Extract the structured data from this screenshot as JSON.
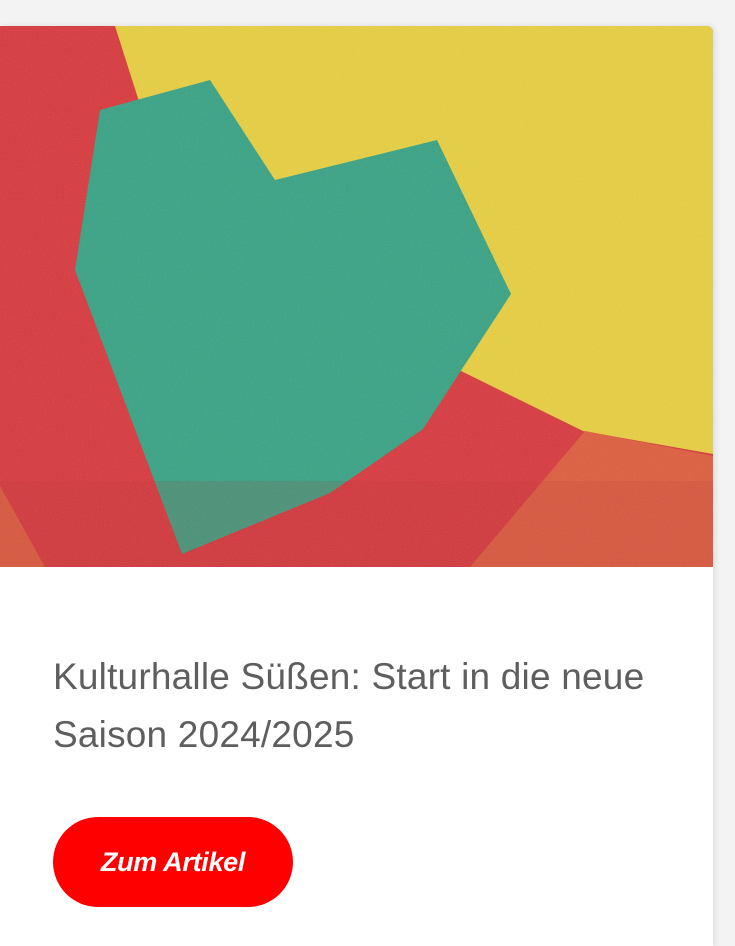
{
  "card": {
    "image": {
      "icon": "geometric-heart-illustration",
      "colors": {
        "yellow": "#e8cf3e",
        "red": "#d8373c",
        "orange": "#df5c3c",
        "green": "#36a283"
      }
    },
    "title": "Kulturhalle Süßen: Start in die neue Saison 2024/2025",
    "button_label": "Zum Artikel",
    "accent_color": "#ff0000"
  }
}
